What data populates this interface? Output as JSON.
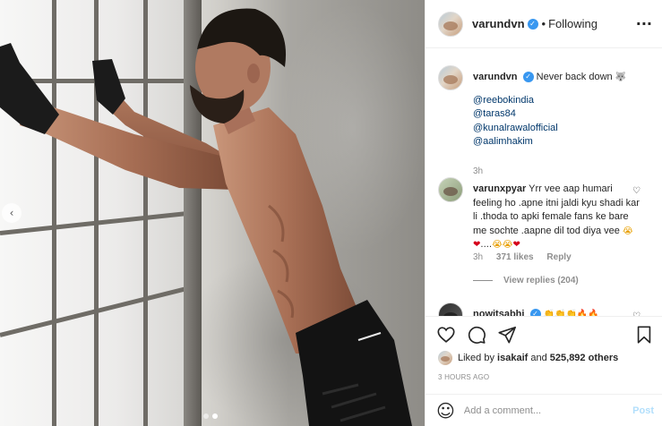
{
  "post": {
    "author": "varundvn",
    "follow_sep": "•",
    "follow_state": "Following",
    "more_icon": "more-dots-icon"
  },
  "caption": {
    "username": "varundvn",
    "text": "Never back down",
    "mentions": [
      "@reebokindia",
      "@taras84",
      "@kunalrawalofficial",
      "@aalimhakim"
    ],
    "time": "3h"
  },
  "comments": [
    {
      "username": "varunxpyar",
      "text": "Yrr vee aap humari feeling ho .apne itni jaldi kyu shadi kar li .thoda to apki female fans ke bare me sochte .aapne dil tod diya vee",
      "time": "3h",
      "likes": "371 likes",
      "reply": "Reply",
      "view_replies": "View replies (204)"
    },
    {
      "username": "nowitsabhi"
    }
  ],
  "likes": {
    "prefix": "Liked by",
    "user": "isakaif",
    "connector": "and",
    "count": "525,892 others"
  },
  "timestamp": "3 HOURS AGO",
  "add_comment": {
    "placeholder": "Add a comment...",
    "post_label": "Post"
  },
  "colors": {
    "verified": "#3897f0",
    "link": "#00376b",
    "muted": "#8e8e8e",
    "post_disabled": "#b2dffc"
  }
}
